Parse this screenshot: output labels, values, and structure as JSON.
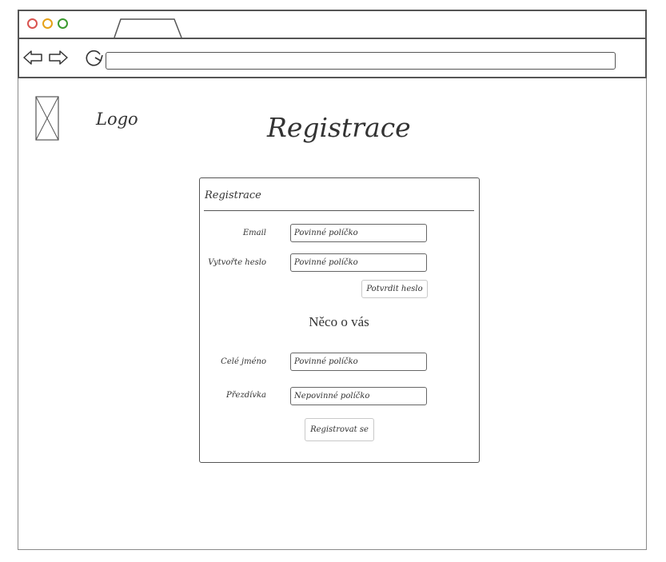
{
  "page": {
    "logo_text": "Logo",
    "title": "Registrace"
  },
  "form": {
    "title": "Registrace",
    "fields": [
      {
        "label": "Email",
        "value": "Povinné políčko"
      },
      {
        "label": "Vytvořte heslo",
        "value": "Povinné políčko"
      },
      {
        "label": "Celé jméno",
        "value": "Povinné políčko"
      },
      {
        "label": "Přezdívka",
        "value": "Nepovinné políčko"
      }
    ],
    "confirm_password_label": "Potvrdit heslo",
    "section_heading": "Něco o vás",
    "submit_label": "Registrovat se"
  },
  "colors": {
    "close_dot": "#d9534f",
    "minimize_dot": "#e6a117",
    "maximize_dot": "#3c9a2f",
    "sketch_stroke": "#555555"
  },
  "icons": {
    "back": "arrow-left-icon",
    "forward": "arrow-right-icon",
    "reload": "reload-icon",
    "logo": "image-placeholder-icon"
  }
}
